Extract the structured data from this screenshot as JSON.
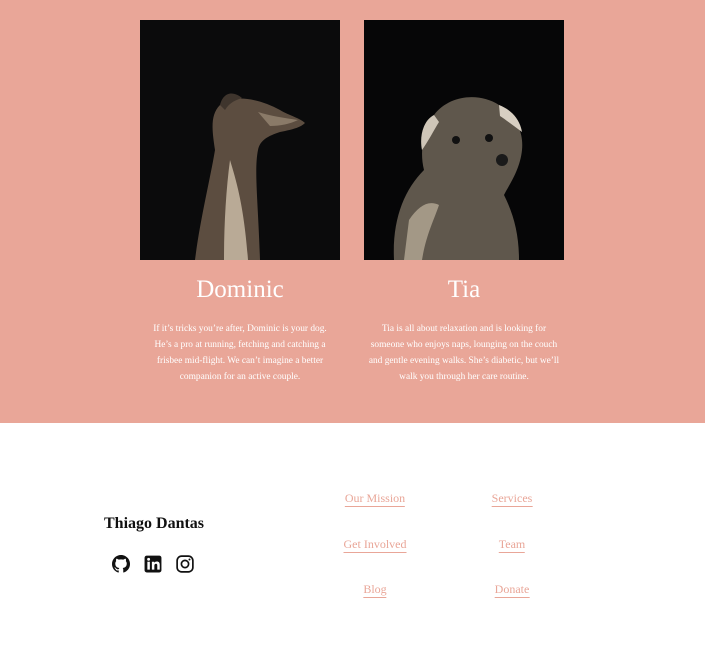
{
  "pets": [
    {
      "name": "Dominic",
      "description": "If it’s tricks you’re after, Dominic is your dog. He’s a pro at running, fetching and catching a frisbee mid-flight. We can’t imagine a better companion for an active couple."
    },
    {
      "name": "Tia",
      "description": "Tia is all about relaxation and is looking for someone who enjoys naps, lounging on the couch and gentle evening walks. She’s diabetic, but we’ll walk you through her care routine."
    }
  ],
  "footer": {
    "brand": "Thiago Dantas",
    "social_icons": [
      "github-icon",
      "linkedin-icon",
      "instagram-icon"
    ],
    "links": {
      "our_mission": "Our Mission",
      "services": "Services",
      "get_involved": "Get Involved",
      "team": "Team",
      "blog": "Blog",
      "donate": "Donate"
    }
  },
  "colors": {
    "accent": "#e9a698",
    "photo_background": "#0b0b0c",
    "text_light": "#ffffff"
  }
}
